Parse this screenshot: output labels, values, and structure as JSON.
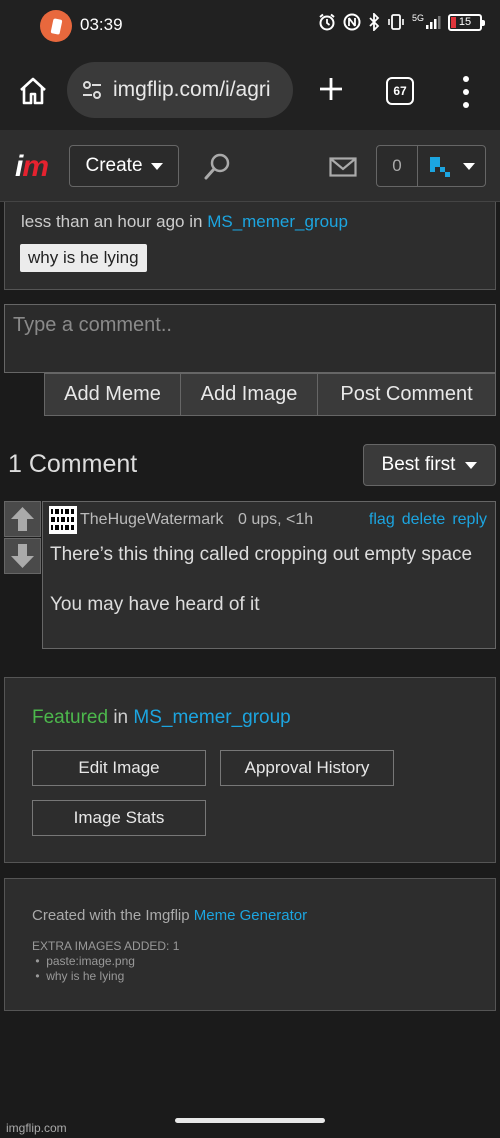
{
  "status_bar": {
    "time": "03:39",
    "network": "5G",
    "battery": "15"
  },
  "browser": {
    "url": "imgflip.com/i/agri",
    "tab_count": "67"
  },
  "header": {
    "logo_i": "i",
    "logo_m": "m",
    "create_label": "Create",
    "notification_count": "0",
    "accent_color": "#1ca5e0"
  },
  "meme": {
    "posted_prefix": "less than an hour ago in ",
    "stream": "MS_memer_group",
    "title": "why is he lying"
  },
  "comment_form": {
    "placeholder": "Type a comment..",
    "add_meme": "Add Meme",
    "add_image": "Add Image",
    "post_comment": "Post Comment"
  },
  "comments": {
    "count_label": "1 Comment",
    "sort_label": "Best first",
    "items": [
      {
        "user": "TheHugeWatermark",
        "meta": "0 ups, <1h",
        "flag": "flag",
        "delete": "delete",
        "reply": "reply",
        "text": "There’s this thing called cropping out empty space\n\nYou may have heard of it"
      }
    ]
  },
  "featured": {
    "label": "Featured",
    "in": " in ",
    "stream": "MS_memer_group",
    "edit_image": "Edit Image",
    "approval_history": "Approval History",
    "image_stats": "Image Stats"
  },
  "created_with": {
    "prefix": "Created with the Imgflip ",
    "link": "Meme Generator",
    "extra_title": "EXTRA IMAGES ADDED: 1",
    "extra_items": [
      "paste:image.png",
      "why is he lying"
    ]
  },
  "watermark": "imgflip.com"
}
